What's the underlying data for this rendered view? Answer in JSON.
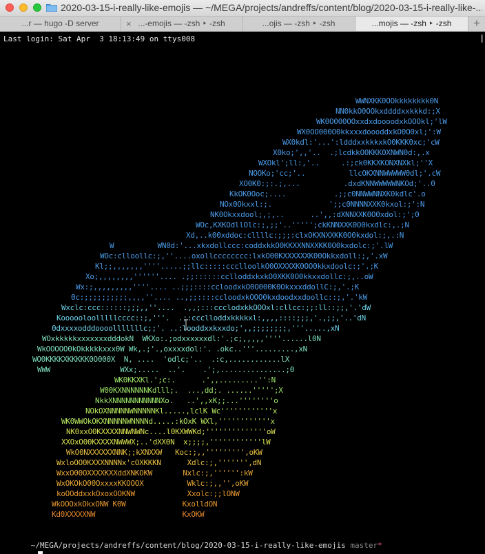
{
  "window": {
    "title": "2020-03-15-i-really-like-emojis — ~/MEGA/projects/andreffs/content/blog/2020-03-15-i-really-like-..."
  },
  "tabs": [
    {
      "label": "...r — hugo -D server",
      "active": false
    },
    {
      "label": "...-emojis — -zsh ‣ -zsh",
      "active": false
    },
    {
      "label": "...ojis — -zsh ‣ -zsh",
      "active": false
    },
    {
      "label": "...mojis — -zsh ‣ -zsh",
      "active": true
    }
  ],
  "tab_close_glyph": "×",
  "new_tab_glyph": "+",
  "terminal": {
    "last_login": "Last login: Sat Apr  3 18:13:49 on ttys008",
    "ascii_art": [
      {
        "text": "WWNXKK0OOkkkkkkkk0N",
        "color": "#4a9be8"
      },
      {
        "text": "NN0kkO0OOkxddddxxkkkd:;X",
        "color": "#4a9be8"
      },
      {
        "text": "WK0O000OOxxdxdoooodxkOOOkl;'lW",
        "color": "#4a9be8"
      },
      {
        "text": "WX0OO000O0kkxxxdoooddxkO0O0xl;':W",
        "color": "#4a9be8"
      },
      {
        "text": "WX0kdl:'...':ldddxxkkkxkO0KKK0xc;'cW",
        "color": "#4a9be8"
      },
      {
        "text": "X0ko;',,'..  .;lcdkkO0KKK0XNWN0d:,.x",
        "color": "#4a9be8"
      },
      {
        "text": "WXOkl';ll:,'..     .:;ck0KKXKONXNXkl;''X",
        "color": "#4a9be8"
      },
      {
        "text": "NOOKo;'cc;'..          llcOKXNNWWWWW0dl;'.cW",
        "color": "#4a9be8"
      },
      {
        "text": "XO0K0:;:.;,...          .dxdKNNWWWWWNKOd;'..0",
        "color": "#4a9be8"
      },
      {
        "text": "KkOK0Ooc;....           .;;c0NNWWNNXK0kdlc'.o",
        "color": "#4a9be8"
      },
      {
        "text": "NOx0Okxxl:;.             ';;c0NNNNXXK0kxol:;':N",
        "color": "#4a9be8"
      },
      {
        "text": "NK0Okxxdool;,;,..      ..',,:dXNNXXK0O0xdol:;';0",
        "color": "#4a9be8"
      },
      {
        "text": "WOc,KXKOdllOlc:;,;;'..''''';ckKNNXXK0O0kxdlc:,.;N",
        "color": "#4a9be8"
      },
      {
        "text": "Xd,..k00xddoc:cllllc:;;;:clxOKXNXXKK0O0kxdol:;,.:N",
        "color": "#4a9be8"
      },
      {
        "text": "W          WN0d:'...xkxdollccc:coddxkkO0KKXXNNXXKK0O0kxdolc:;'.lW",
        "color": "#4a9be8"
      },
      {
        "text": "WOc:clloollc:;,''....oxollcccccccc:lxkO00KXXXXXXK00Okkxdoll:;,'.xW",
        "color": "#4a9be8"
      },
      {
        "text": "Kl;;,,,,,,,''''.....;;llc:::::ccclloolkO0OXXXXK0OO0kkxdoolc:;'.;K",
        "color": "#4a9be8"
      },
      {
        "text": "Xo;,,,,,,,,''''''.... .;;::::::cclloddxkxkO0XKK0O0kkxxdollc:;,..oW",
        "color": "#4a9be8"
      },
      {
        "text": "Wx:;,,,,,,,,,''''.... ..;;;::::ccloodxkO0O000K0OkxxxddollC:;,'.;K",
        "color": "#4a9be8"
      },
      {
        "text": "0c:;;;;;;;;;;,,,,''.... ..,;;::::ccloodxkOOO0kxdoodxxdoollc::;,'.'kW",
        "color": "#4a9be8"
      },
      {
        "text": "Wxclc:ccc::::::;;;,,''....  .,,;:::ccclodxkkOOOxl:cllcc:;;:ll::;;,'.'dW",
        "color": "#6fd0e8"
      },
      {
        "text": "Koooooloolllllcccc::;,'''.  .;:ccclloddxkkkkxl:,,,,::::;;;,'.,;;,'..'dN",
        "color": "#6fd0e8"
      },
      {
        "text": "0dxxxxodddoooolllllllc;;'. ..:looddxxkxxdo;',,;;;;;;;;,'''.....,xN",
        "color": "#6fd0e8"
      },
      {
        "text": "WOxkkkkkxxxxxxxdddokN  WKXo:.;odxxxxxxdl:'.;c;,,,,,''''......l0N",
        "color": "#7ee0c0"
      },
      {
        "text": "WkOOOOO0kOkkkkkxxx0W Wk,.;'.,oxxxxdol:'. .okc..'''.........,xN",
        "color": "#7ee0c0"
      },
      {
        "text": "WO0KKKKXKKKKK0O000X  N, ....  'odlc;'..  .:c,............lX",
        "color": "#7ee0c0"
      },
      {
        "text": "WWW                WXx;.....  ..'.    .';,...............;0",
        "color": "#7ee0c0"
      },
      {
        "text": "WK0KKXKl.';c:.      .',,.........'':N",
        "color": "#9ee86a"
      },
      {
        "text": "W00KXNNNNNNKdlll;.  ...,dd;. ......''''';X",
        "color": "#9ee86a"
      },
      {
        "text": "NkkXNNNNNNNNNNNXo.   ..',,xK;;...''''''''o",
        "color": "#9ee86a"
      },
      {
        "text": "NOkOXNNNNNWNNNNNKl.....,lclK Wc''''''''''''x",
        "color": "#b8e860"
      },
      {
        "text": "WK0WWOkOKXNNNNNWNNNNd.....:kOxK WXl,''''''''''''x",
        "color": "#b8e860"
      },
      {
        "text": "NK0xxO0KXXXXNNWNWNc....l0KXWWKd;''''''''''''''oW",
        "color": "#d8e050"
      },
      {
        "text": "XXOxO00KXXXXNWWWX;..'dXX0N  x;;;;,''''''''''''lW",
        "color": "#d8e050"
      },
      {
        "text": "WkO0NXXXXXXNNK;;kXNXXW   Koc:;,,''''''''',oKW",
        "color": "#e8c040"
      },
      {
        "text": "WxloOO0KXXXNNNNx'cOXKKKN      Xdlc:;,''''''',dN",
        "color": "#e8c040"
      },
      {
        "text": "WxxO00OXXXXKXXddXNKOKW       Nxlc:;,'''''':kW",
        "color": "#e8a838"
      },
      {
        "text": "WxOKOkO00OxxxxKKOOOX          Wklc:;,,'',oKW",
        "color": "#e8a838"
      },
      {
        "text": "koOOddxxkOxoxOOKNW            Xxolc:;;lONW",
        "color": "#e89830"
      },
      {
        "text": "WkOOOxkOkxONW K0W             KxolldON",
        "color": "#e89830"
      },
      {
        "text": "Kd0XXXXXNW                    KxOKW",
        "color": "#e88a30"
      }
    ],
    "prompt": {
      "path": "~/MEGA/projects/andreffs/content/blog/2020-03-15-i-really-like-emojis",
      "branch": "master",
      "dirty_marker": "*",
      "arrow": "›"
    }
  }
}
